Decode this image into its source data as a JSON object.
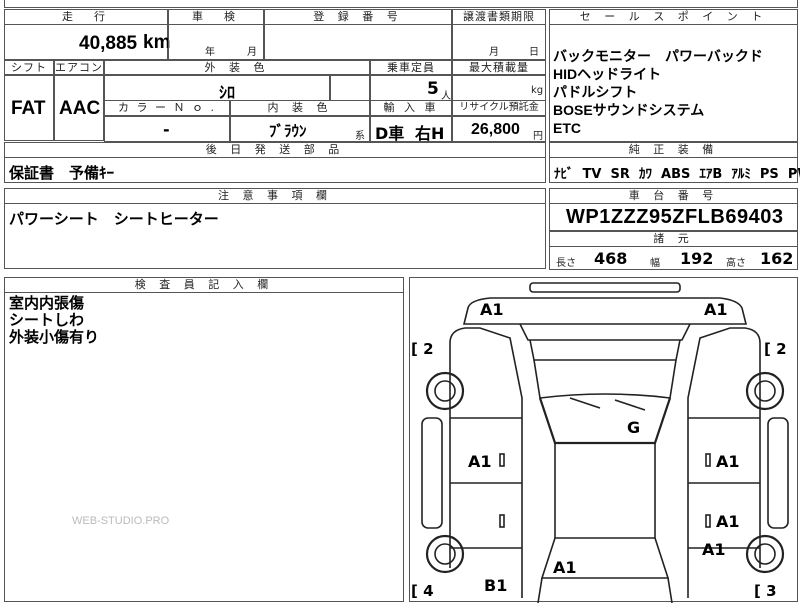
{
  "headers": {
    "mileage": "走　行",
    "inspection": "車　検",
    "registration": "登 録 番 号",
    "transfer_deadline": "譲渡書類期限",
    "sales_points": "セ ー ル ス ポ イ ン ト",
    "shift": "シフト",
    "aircon": "エアコン",
    "exterior_color": "外 装 色",
    "capacity": "乗車定員",
    "max_load": "最大積載量",
    "color_no": "カ ラ ー Ｎ ｏ .",
    "interior_color": "内 装 色",
    "import": "輸 入 車",
    "recycle_fee": "リサイクル預託金",
    "later_parts": "後 日 発 送 部 品",
    "genuine_equipment": "純 正 装 備",
    "notes": "注 意 事 項 欄",
    "chassis_number": "車 台 番 号",
    "dimensions": "諸 元",
    "inspector": "検 査 員 記 入 欄"
  },
  "mileage": {
    "value": "40,885",
    "unit": "km"
  },
  "inspection": {
    "year_unit": "年",
    "month_unit": "月"
  },
  "transfer_deadline": {
    "month_unit": "月",
    "day_unit": "日"
  },
  "shift": "FAT",
  "aircon": "AAC",
  "exterior_color": "ｼﾛ",
  "capacity": {
    "value": "5",
    "unit": "人"
  },
  "max_load": {
    "value": "",
    "unit": "kg"
  },
  "color_no": "-",
  "interior_color": {
    "value": "ﾌﾞﾗｳﾝ",
    "suffix": "系"
  },
  "import": {
    "drive": "D車",
    "steering": "右H"
  },
  "recycle_fee": {
    "value": "26,800",
    "unit": "円"
  },
  "later_parts": "保証書　予備ｷｰ",
  "sales_points": [
    "バックモニター　パワーバックド",
    "HIDヘッドライト",
    "パドルシフト",
    "BOSEサウンドシステム",
    "ETC"
  ],
  "genuine_equipment": "ﾅﾋﾞ  TV  SR  ｶﾜ  ABS  ｴｱB  ｱﾙﾐ  PS  PW",
  "notes": "パワーシート　シートヒーター",
  "chassis_number": "WP1ZZZ95ZFLB69403",
  "dimensions": {
    "length_label": "長さ",
    "length": "468",
    "width_label": "幅",
    "width": "192",
    "height_label": "高さ",
    "height": "162"
  },
  "inspector_notes": [
    "室内内張傷",
    "シートしわ",
    "外装小傷有り"
  ],
  "watermark": "WEB-STUDIO.PRO",
  "diagram_marks": {
    "front_left": "A1",
    "front_right": "A1",
    "bracket_left_top": "[ 2",
    "bracket_right_top": "[ 2",
    "bracket_left_bottom": "[ 4",
    "bracket_right_bottom": "[ 3",
    "roof": "G",
    "front_door_left": "A1",
    "front_door_right": "A1",
    "rear_door_right": "A1",
    "rear_fender_right": "A1",
    "rear_bumper": "A1",
    "rear_left": "B1"
  }
}
